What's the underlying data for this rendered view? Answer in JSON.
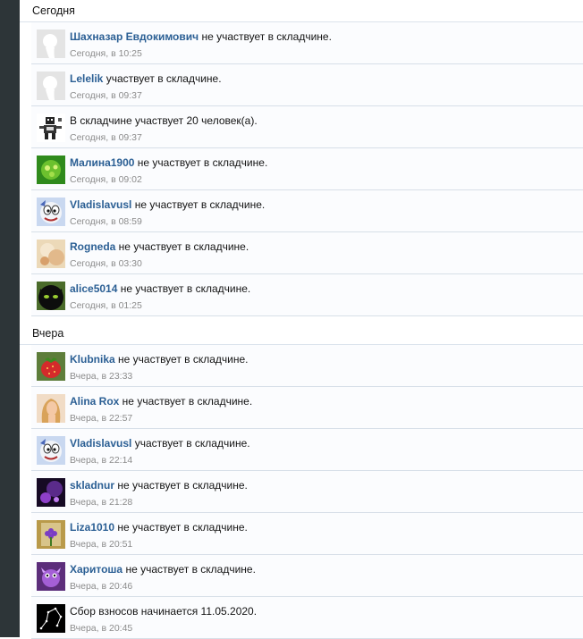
{
  "sections": [
    {
      "header": "Сегодня",
      "items": [
        {
          "user": "Шахназар Евдокимович",
          "action": " не участвует в складчине.",
          "time": "Сегодня, в 10:25",
          "avatar_icon": "default-avatar-icon"
        },
        {
          "user": "Lelelik",
          "action": " участвует в складчине.",
          "time": "Сегодня, в 09:37",
          "avatar_icon": "default-avatar-icon"
        },
        {
          "user": "",
          "action": "В складчине участвует 20 человек(а).",
          "time": "Сегодня, в 09:37",
          "avatar_icon": "system-robot-avatar-icon"
        },
        {
          "user": "Малина1900",
          "action": " не участвует в складчине.",
          "time": "Сегодня, в 09:02",
          "avatar_icon": "green-avatar-icon"
        },
        {
          "user": "Vladislavusl",
          "action": " не участвует в складчине.",
          "time": "Сегодня, в 08:59",
          "avatar_icon": "cartoon-avatar-icon"
        },
        {
          "user": "Rogneda",
          "action": " не участвует в складчине.",
          "time": "Сегодня, в 03:30",
          "avatar_icon": "flower-avatar-icon"
        },
        {
          "user": "alice5014",
          "action": " не участвует в складчине.",
          "time": "Сегодня, в 01:25",
          "avatar_icon": "black-cat-avatar-icon"
        }
      ]
    },
    {
      "header": "Вчера",
      "items": [
        {
          "user": "Klubnika",
          "action": " не участвует в складчине.",
          "time": "Вчера, в 23:33",
          "avatar_icon": "strawberry-avatar-icon"
        },
        {
          "user": "Alina Rox",
          "action": " не участвует в складчине.",
          "time": "Вчера, в 22:57",
          "avatar_icon": "woman-portrait-avatar-icon"
        },
        {
          "user": "Vladislavusl",
          "action": " участвует в складчине.",
          "time": "Вчера, в 22:14",
          "avatar_icon": "cartoon-avatar-icon"
        },
        {
          "user": "skladnur",
          "action": " не участвует в складчине.",
          "time": "Вчера, в 21:28",
          "avatar_icon": "purple-dark-avatar-icon"
        },
        {
          "user": "Liza1010",
          "action": " не участвует в складчине.",
          "time": "Вчера, в 20:51",
          "avatar_icon": "purple-flower-avatar-icon"
        },
        {
          "user": "Харитоша",
          "action": " не участвует в складчине.",
          "time": "Вчера, в 20:46",
          "avatar_icon": "purple-creature-avatar-icon"
        },
        {
          "user": "",
          "action": "Сбор взносов начинается 11.05.2020.",
          "time": "Вчера, в 20:45",
          "avatar_icon": "constellation-avatar-icon"
        }
      ]
    }
  ]
}
